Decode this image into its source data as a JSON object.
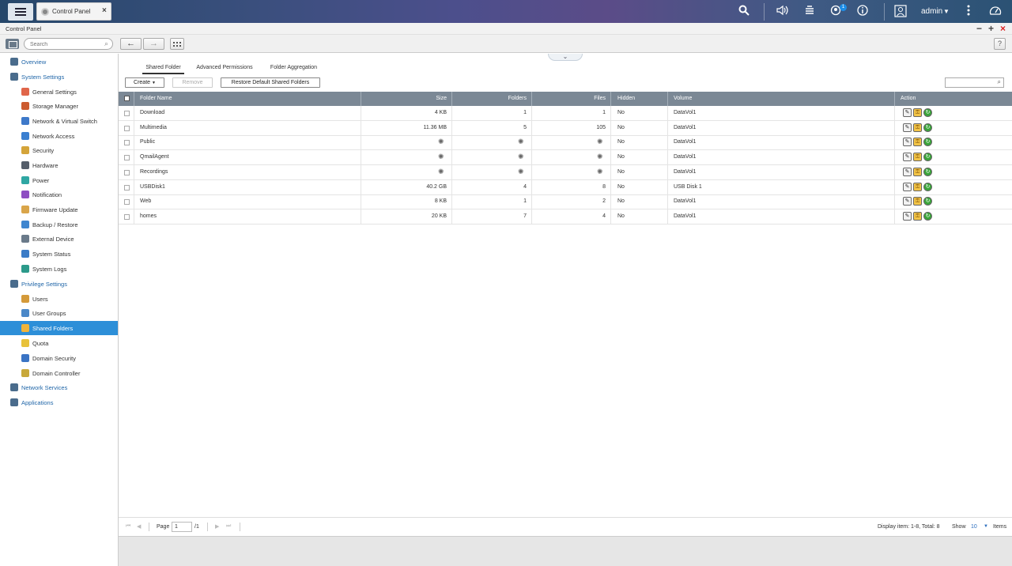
{
  "topbar": {
    "tab_label": "Control Panel",
    "notification_count": "1",
    "user": "admin"
  },
  "window": {
    "title": "Control Panel"
  },
  "toolbar": {
    "search_placeholder": "Search"
  },
  "sidebar": {
    "items": [
      {
        "label": "Overview",
        "type": "group",
        "icon": "overview-icon",
        "color": "#4a6c8c"
      },
      {
        "label": "System Settings",
        "type": "group",
        "icon": "gear-icon",
        "color": "#4a6c8c"
      },
      {
        "label": "General Settings",
        "type": "child",
        "icon": "general-settings-icon",
        "color": "#e0664a"
      },
      {
        "label": "Storage Manager",
        "type": "child",
        "icon": "storage-icon",
        "color": "#cc5b2f"
      },
      {
        "label": "Network & Virtual Switch",
        "type": "child",
        "icon": "network-switch-icon",
        "color": "#3e79c9"
      },
      {
        "label": "Network Access",
        "type": "child",
        "icon": "network-access-icon",
        "color": "#3a7fd0"
      },
      {
        "label": "Security",
        "type": "child",
        "icon": "lock-icon",
        "color": "#d4a43a"
      },
      {
        "label": "Hardware",
        "type": "child",
        "icon": "hardware-icon",
        "color": "#555e6a"
      },
      {
        "label": "Power",
        "type": "child",
        "icon": "power-icon",
        "color": "#2fa7a3"
      },
      {
        "label": "Notification",
        "type": "child",
        "icon": "notification-icon",
        "color": "#8e4fc2"
      },
      {
        "label": "Firmware Update",
        "type": "child",
        "icon": "firmware-icon",
        "color": "#d9a54a"
      },
      {
        "label": "Backup / Restore",
        "type": "child",
        "icon": "backup-icon",
        "color": "#3f86cf"
      },
      {
        "label": "External Device",
        "type": "child",
        "icon": "external-device-icon",
        "color": "#6a7a8a"
      },
      {
        "label": "System Status",
        "type": "child",
        "icon": "system-status-icon",
        "color": "#3b7cc7"
      },
      {
        "label": "System Logs",
        "type": "child",
        "icon": "system-logs-icon",
        "color": "#2c9a8a"
      },
      {
        "label": "Privilege Settings",
        "type": "group",
        "icon": "user-icon",
        "color": "#4a6c8c"
      },
      {
        "label": "Users",
        "type": "child",
        "icon": "users-icon",
        "color": "#d49a3a"
      },
      {
        "label": "User Groups",
        "type": "child",
        "icon": "user-groups-icon",
        "color": "#4b88c8"
      },
      {
        "label": "Shared Folders",
        "type": "child",
        "icon": "shared-folder-icon",
        "color": "#f0b43a",
        "selected": true
      },
      {
        "label": "Quota",
        "type": "child",
        "icon": "quota-icon",
        "color": "#e8c23a"
      },
      {
        "label": "Domain Security",
        "type": "child",
        "icon": "domain-security-icon",
        "color": "#3a74c4"
      },
      {
        "label": "Domain Controller",
        "type": "child",
        "icon": "domain-controller-icon",
        "color": "#c8a83a"
      },
      {
        "label": "Network Services",
        "type": "group",
        "icon": "globe-icon",
        "color": "#4a6c8c"
      },
      {
        "label": "Applications",
        "type": "group",
        "icon": "applications-icon",
        "color": "#4a6c8c"
      }
    ]
  },
  "subtabs": [
    "Shared Folder",
    "Advanced Permissions",
    "Folder Aggregation"
  ],
  "actions": {
    "create": "Create",
    "remove": "Remove",
    "restore": "Restore Default Shared Folders"
  },
  "table": {
    "columns": [
      "Folder Name",
      "Size",
      "Folders",
      "Files",
      "Hidden",
      "Volume",
      "Action"
    ],
    "rows": [
      {
        "name": "Download",
        "size": "4 KB",
        "folders": "1",
        "files": "1",
        "hidden": "No",
        "volume": "DataVol1",
        "loading": false
      },
      {
        "name": "Multimedia",
        "size": "11.36 MB",
        "folders": "5",
        "files": "105",
        "hidden": "No",
        "volume": "DataVol1",
        "loading": false
      },
      {
        "name": "Public",
        "size": "",
        "folders": "",
        "files": "",
        "hidden": "No",
        "volume": "DataVol1",
        "loading": true
      },
      {
        "name": "QmailAgent",
        "size": "",
        "folders": "",
        "files": "",
        "hidden": "No",
        "volume": "DataVol1",
        "loading": true
      },
      {
        "name": "Recordings",
        "size": "",
        "folders": "",
        "files": "",
        "hidden": "No",
        "volume": "DataVol1",
        "loading": true
      },
      {
        "name": "USBDisk1",
        "size": "40.2 GB",
        "folders": "4",
        "files": "8",
        "hidden": "No",
        "volume": "USB Disk 1",
        "loading": false
      },
      {
        "name": "Web",
        "size": "8 KB",
        "folders": "1",
        "files": "2",
        "hidden": "No",
        "volume": "DataVol1",
        "loading": false
      },
      {
        "name": "homes",
        "size": "20 KB",
        "folders": "7",
        "files": "4",
        "hidden": "No",
        "volume": "DataVol1",
        "loading": false
      }
    ]
  },
  "pager": {
    "page_label": "Page",
    "page_value": "1",
    "page_total": "/1",
    "display": "Display item: 1-8, Total: 8",
    "show_label": "Show",
    "show_value": "10",
    "items_label": "Items"
  }
}
